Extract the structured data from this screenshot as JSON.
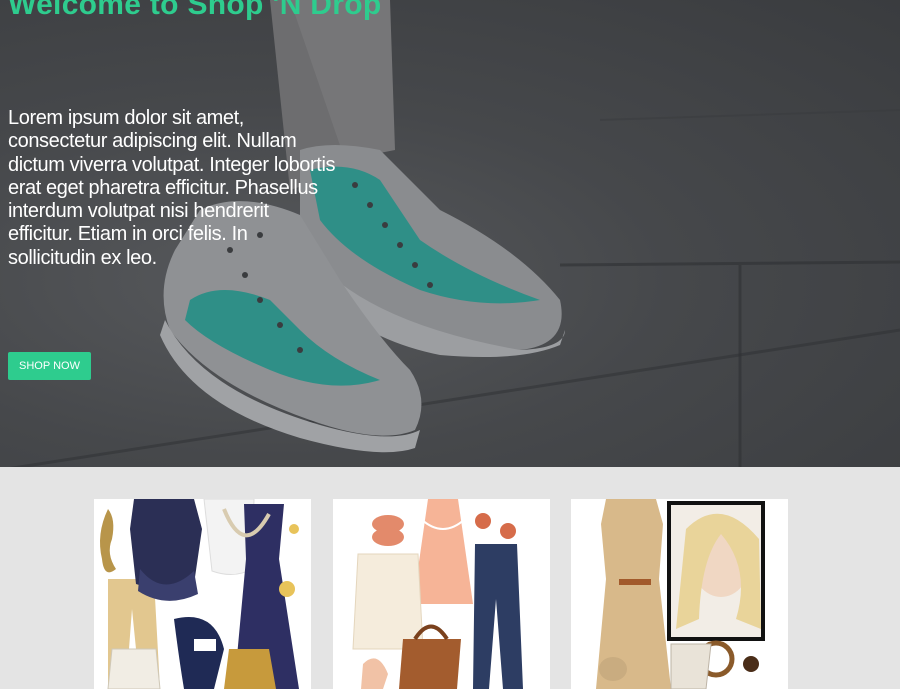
{
  "hero": {
    "title": "Welcome to Shop 'N Drop",
    "body": "Lorem ipsum dolor sit amet, consectetur adipiscing elit. Nullam dictum viverra volutpat. Integer lobortis erat eget pharetra efficitur. Phasellus interdum volutpat nisi hendrerit efficitur. Etiam in orci felis. In sollicitudin ex leo.",
    "cta_label": "SHOP NOW",
    "background": "sneakers-on-pavement-photo"
  },
  "colors": {
    "accent": "#2ecc8e",
    "hero_overlay": "#45474a",
    "section_bg": "#e4e4e4"
  },
  "products": [
    {
      "image": "navy-outfit-collage"
    },
    {
      "image": "peach-outfit-collage"
    },
    {
      "image": "beige-dress-collage"
    }
  ]
}
